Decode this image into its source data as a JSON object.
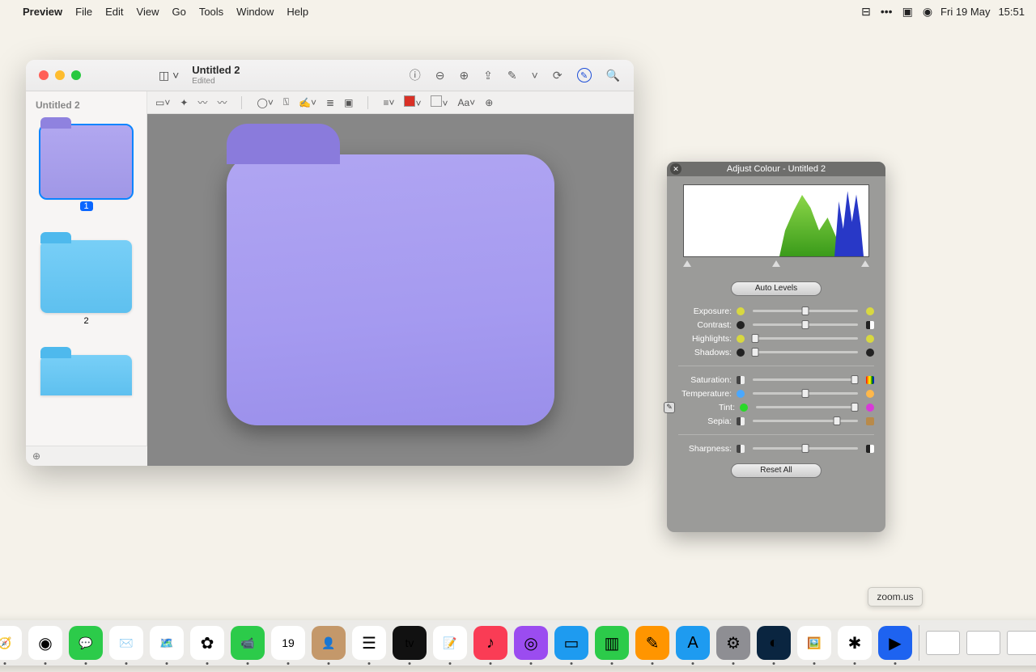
{
  "menubar": {
    "app": "Preview",
    "items": [
      "File",
      "Edit",
      "View",
      "Go",
      "Tools",
      "Window",
      "Help"
    ],
    "date": "Fri 19 May",
    "time": "15:51"
  },
  "window": {
    "title": "Untitled 2",
    "subtitle": "Edited",
    "sidebar_title": "Untitled 2",
    "thumbs": [
      {
        "label": "1",
        "selected": true,
        "color": "purple"
      },
      {
        "label": "2",
        "selected": false,
        "color": "blue"
      },
      {
        "label": "",
        "selected": false,
        "color": "blue"
      }
    ]
  },
  "adjust": {
    "title": "Adjust Colour - Untitled 2",
    "auto_levels": "Auto Levels",
    "reset_all": "Reset All",
    "sliders1": [
      {
        "name": "Exposure:",
        "pos": 50,
        "left": "sun",
        "right": "sun"
      },
      {
        "name": "Contrast:",
        "pos": 50,
        "left": "dark",
        "right": "half"
      },
      {
        "name": "Highlights:",
        "pos": 2,
        "left": "sun",
        "right": "sun"
      },
      {
        "name": "Shadows:",
        "pos": 2,
        "left": "dark",
        "right": "dark"
      }
    ],
    "sliders2": [
      {
        "name": "Saturation:",
        "pos": 97,
        "left": "bw",
        "right": "rain",
        "eyedrop": false
      },
      {
        "name": "Temperature:",
        "pos": 50,
        "left": "blue",
        "right": "warm",
        "eyedrop": false
      },
      {
        "name": "Tint:",
        "pos": 97,
        "left": "grn",
        "right": "mag",
        "eyedrop": true
      },
      {
        "name": "Sepia:",
        "pos": 80,
        "left": "bw",
        "right": "sep",
        "eyedrop": false
      }
    ],
    "sliders3": [
      {
        "name": "Sharpness:",
        "pos": 50,
        "left": "bw",
        "right": "half"
      }
    ]
  },
  "dock": {
    "tooltip": "zoom.us",
    "apps": [
      {
        "n": "finder",
        "bg": "#1e9bf0",
        "g": "🙂"
      },
      {
        "n": "launchpad",
        "bg": "#eee",
        "g": "▦"
      },
      {
        "n": "safari",
        "bg": "#fff",
        "g": "🧭"
      },
      {
        "n": "chrome",
        "bg": "#fff",
        "g": "◉"
      },
      {
        "n": "messages",
        "bg": "#2ccb4a",
        "g": "💬"
      },
      {
        "n": "mail",
        "bg": "#fff",
        "g": "✉️"
      },
      {
        "n": "maps",
        "bg": "#fff",
        "g": "🗺️"
      },
      {
        "n": "photos",
        "bg": "#fff",
        "g": "✿"
      },
      {
        "n": "facetime",
        "bg": "#2ccb4a",
        "g": "📹"
      },
      {
        "n": "calendar",
        "bg": "#fff",
        "g": "19"
      },
      {
        "n": "contacts",
        "bg": "#c4986a",
        "g": "👤"
      },
      {
        "n": "reminders",
        "bg": "#fff",
        "g": "☰"
      },
      {
        "n": "tv",
        "bg": "#111",
        "g": "tv"
      },
      {
        "n": "notes",
        "bg": "#fff",
        "g": "📝"
      },
      {
        "n": "music",
        "bg": "#fa3c55",
        "g": "♪"
      },
      {
        "n": "podcasts",
        "bg": "#9b4cf0",
        "g": "◎"
      },
      {
        "n": "keynote",
        "bg": "#1e9bf0",
        "g": "▭"
      },
      {
        "n": "numbers",
        "bg": "#2ccb4a",
        "g": "▥"
      },
      {
        "n": "pages",
        "bg": "#ff9500",
        "g": "✎"
      },
      {
        "n": "appstore",
        "bg": "#1e9bf0",
        "g": "A"
      },
      {
        "n": "settings",
        "bg": "#8e8e93",
        "g": "⚙"
      },
      {
        "n": "unknown",
        "bg": "#0a2540",
        "g": "◐"
      },
      {
        "n": "preview",
        "bg": "#fff",
        "g": "🖼️"
      },
      {
        "n": "slack",
        "bg": "#fff",
        "g": "✱"
      },
      {
        "n": "zoom",
        "bg": "#1e63f0",
        "g": "▶"
      }
    ]
  }
}
